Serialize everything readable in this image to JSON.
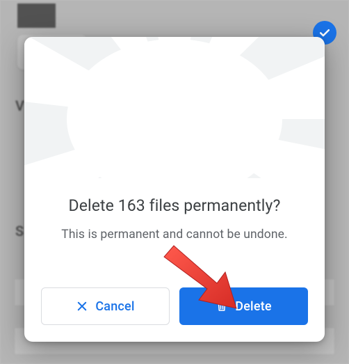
{
  "dialog": {
    "title": "Delete 163 files permanently?",
    "subtitle": "This is permanent and cannot be undone.",
    "cancel_label": "Cancel",
    "delete_label": "Delete"
  },
  "colors": {
    "primary": "#1a73e8",
    "text": "#3c4043",
    "muted": "#5f6368",
    "border": "#dadce0"
  },
  "annotation": {
    "arrow_target": "delete-button"
  }
}
